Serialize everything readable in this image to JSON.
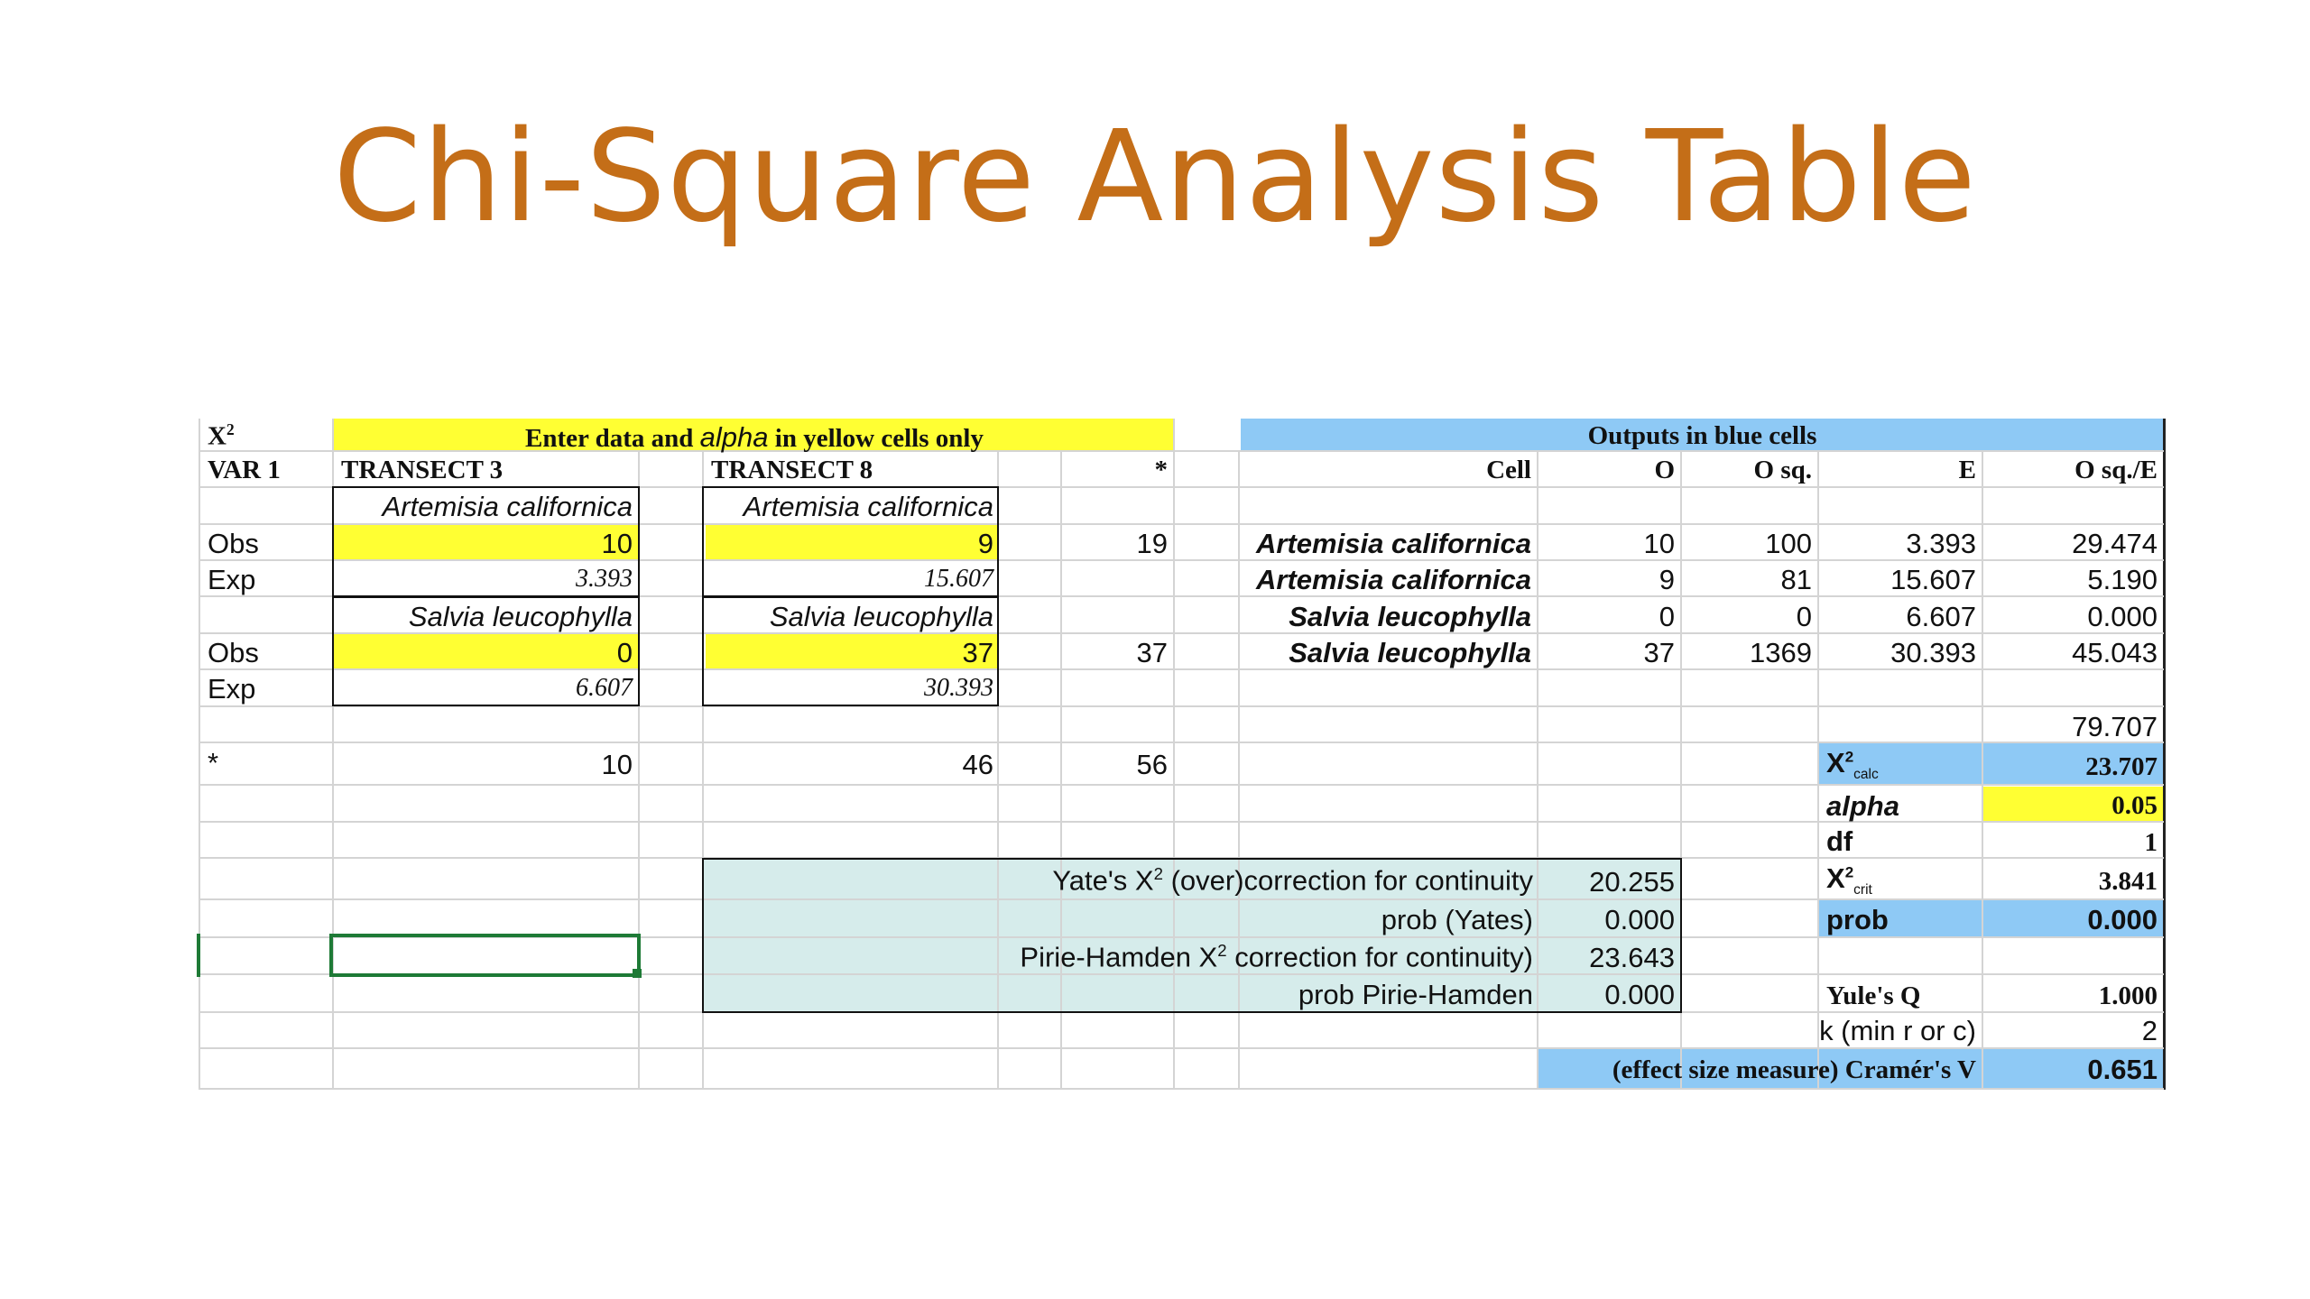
{
  "title": "Chi-Square Analysis Table",
  "sheet": {
    "chi_symbol": "X",
    "chi_sup": "2",
    "banner_input_pre": "Enter data and",
    "banner_input_alpha": "alpha",
    "banner_input_post": "in yellow cells only",
    "banner_output": "Outputs in blue cells",
    "var_label": "VAR 1",
    "transect_a": "TRANSECT 3",
    "transect_b": "TRANSECT 8",
    "star": "*",
    "species_1": "Artemisia californica",
    "species_2": "Salvia leucophylla",
    "obs_label": "Obs",
    "exp_label": "Exp",
    "t3_obs1": "10",
    "t3_exp1": "3.393",
    "t3_obs2": "0",
    "t3_exp2": "6.607",
    "t8_obs1": "9",
    "t8_exp1": "15.607",
    "t8_obs2": "37",
    "t8_exp2": "30.393",
    "row_total_1": "19",
    "row_total_2": "37",
    "col_total_a": "10",
    "col_total_b": "46",
    "grand_total": "56"
  },
  "outputs": {
    "headers": {
      "cell": "Cell",
      "o": "O",
      "osq": "O sq.",
      "e": "E",
      "osq_e": "O sq./E"
    },
    "rows": [
      {
        "cell": "Artemisia californica",
        "o": "10",
        "osq": "100",
        "e": "3.393",
        "osq_e": "29.474"
      },
      {
        "cell": "Artemisia californica",
        "o": "9",
        "osq": "81",
        "e": "15.607",
        "osq_e": "5.190"
      },
      {
        "cell": "Salvia leucophylla",
        "o": "0",
        "osq": "0",
        "e": "6.607",
        "osq_e": "0.000"
      },
      {
        "cell": "Salvia leucophylla",
        "o": "37",
        "osq": "1369",
        "e": "30.393",
        "osq_e": "45.043"
      }
    ],
    "sum": "79.707",
    "x2calc_sub": "calc",
    "x2calc": "23.707",
    "alpha_label": "alpha",
    "alpha": "0.05",
    "df_label": "df",
    "df": "1",
    "x2crit_sub": "crit",
    "x2crit": "3.841",
    "prob_label": "prob",
    "prob": "0.000",
    "yule_label": "Yule's Q",
    "yule": "1.000",
    "k_label": "k (min r or c)",
    "k": "2",
    "cramer_label": "(effect size measure) Cramér's V",
    "cramer": "0.651"
  },
  "corrections": {
    "yates_pre": "Yate's X",
    "yates_post": " (over)correction for continuity",
    "yates": "20.255",
    "prob_yates_label": "prob (Yates)",
    "prob_yates": "0.000",
    "pirie_pre": "Pirie-Hamden X",
    "pirie_post": " correction for continuity)",
    "pirie": "23.643",
    "prob_pirie_label": "prob Pirie-Hamden",
    "prob_pirie": "0.000"
  },
  "colors": {
    "title": "#c46e18",
    "input_yellow": "#ffff33",
    "output_blue": "#8ec9f5",
    "correction_teal": "#d6eceb",
    "selection_green": "#1e7a36"
  }
}
